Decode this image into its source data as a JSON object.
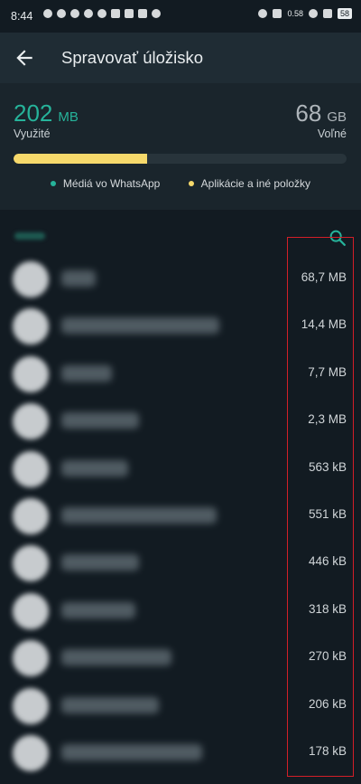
{
  "status_bar": {
    "time": "8:44",
    "network_speed": "0.58",
    "battery": "58"
  },
  "header": {
    "title": "Spravovať úložisko"
  },
  "storage": {
    "used_value": "202",
    "used_unit": "MB",
    "used_label": "Využité",
    "free_value": "68",
    "free_unit": "GB",
    "free_label": "Voľné",
    "used_fraction": 0.4
  },
  "legend": {
    "media_label": "Médiá vo WhatsApp",
    "apps_label": "Aplikácie a iné položky",
    "media_color": "#26b39a",
    "apps_color": "#f6d96b"
  },
  "chats": [
    {
      "size": "68,7 MB"
    },
    {
      "size": "14,4 MB"
    },
    {
      "size": "7,7 MB"
    },
    {
      "size": "2,3 MB"
    },
    {
      "size": "563 kB"
    },
    {
      "size": "551 kB"
    },
    {
      "size": "446 kB"
    },
    {
      "size": "318 kB"
    },
    {
      "size": "270 kB"
    },
    {
      "size": "206 kB"
    },
    {
      "size": "178 kB"
    }
  ],
  "colors": {
    "accent": "#26b39a",
    "bar_fill": "#f6d96b",
    "highlight": "#d21f28"
  }
}
